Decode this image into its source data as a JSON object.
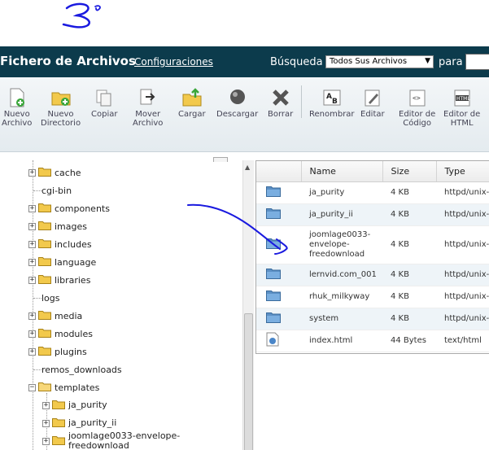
{
  "header": {
    "title": "Fichero de Archivos",
    "settings_link": "Configuraciones",
    "search_label": "Búsqueda",
    "search_scope": "Todos Sus Archivos",
    "para_label": "para",
    "search_value": ""
  },
  "toolbar": {
    "new_file": "Nuevo\nArchivo",
    "new_folder": "Nuevo\nDirectorio",
    "copy": "Copiar",
    "move": "Mover\nArchivo",
    "upload": "Cargar",
    "download": "Descargar",
    "delete": "Borrar",
    "rename": "Renombrar",
    "edit": "Editar",
    "code_editor": "Editor de\nCódigo",
    "html_editor": "Editor de\nHTML"
  },
  "tree": {
    "items": [
      {
        "label": "cache",
        "expandable": true
      },
      {
        "label": "cgi-bin",
        "expandable": false
      },
      {
        "label": "components",
        "expandable": true
      },
      {
        "label": "images",
        "expandable": true
      },
      {
        "label": "includes",
        "expandable": true
      },
      {
        "label": "language",
        "expandable": true
      },
      {
        "label": "libraries",
        "expandable": true
      },
      {
        "label": "logs",
        "expandable": false
      },
      {
        "label": "media",
        "expandable": true
      },
      {
        "label": "modules",
        "expandable": true
      },
      {
        "label": "plugins",
        "expandable": true
      },
      {
        "label": "remos_downloads",
        "expandable": false
      },
      {
        "label": "templates",
        "expandable": true,
        "expanded": true
      }
    ],
    "children": [
      {
        "label": "ja_purity"
      },
      {
        "label": "ja_purity_ii"
      },
      {
        "label": "joomlage0033-envelope-\nfreedownload"
      }
    ]
  },
  "files": {
    "columns": [
      "Name",
      "Size",
      "Type"
    ],
    "rows": [
      {
        "name": "ja_purity",
        "size": "4 KB",
        "type": "httpd/unix-d",
        "kind": "folder"
      },
      {
        "name": "ja_purity_ii",
        "size": "4 KB",
        "type": "httpd/unix-d",
        "kind": "folder"
      },
      {
        "name": "joomlage0033-\nenvelope-\nfreedownload",
        "size": "4 KB",
        "type": "httpd/unix-d",
        "kind": "folder"
      },
      {
        "name": "lernvid.com_001",
        "size": "4 KB",
        "type": "httpd/unix-d",
        "kind": "folder"
      },
      {
        "name": "rhuk_milkyway",
        "size": "4 KB",
        "type": "httpd/unix-d",
        "kind": "folder"
      },
      {
        "name": "system",
        "size": "4 KB",
        "type": "httpd/unix-d",
        "kind": "folder"
      },
      {
        "name": "index.html",
        "size": "44 Bytes",
        "type": "text/html",
        "kind": "file"
      }
    ]
  },
  "colors": {
    "header_bg": "#0c3b4c",
    "annotation_ink": "#1a1adf"
  }
}
